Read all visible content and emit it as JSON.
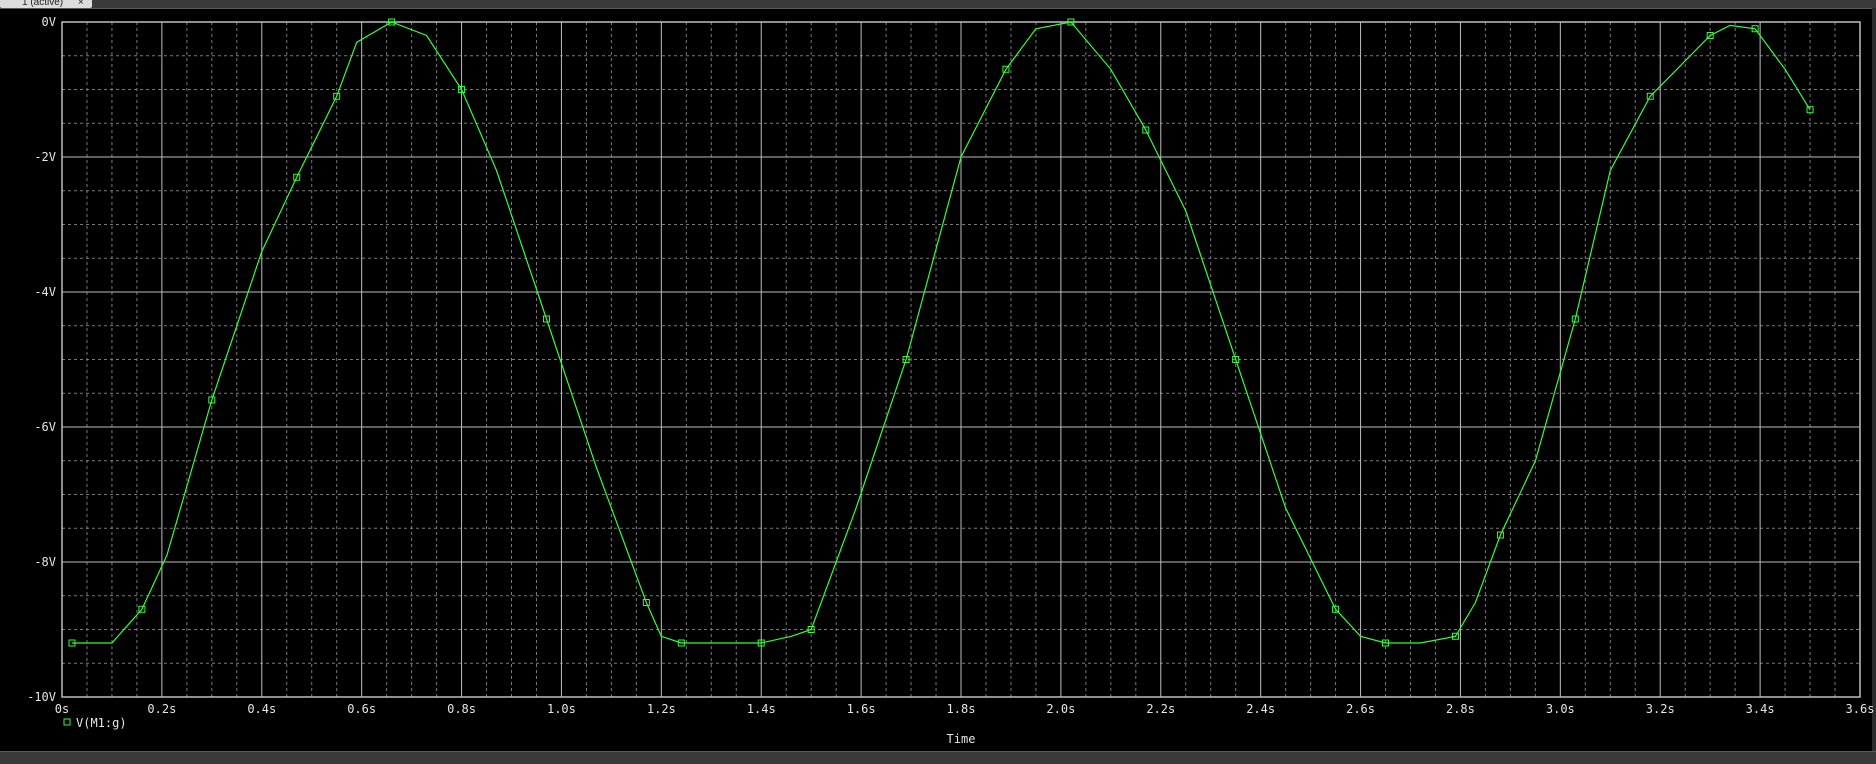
{
  "window": {
    "tab_label": "1 (active)",
    "tab_close": "×"
  },
  "colors": {
    "background": "#000000",
    "grid_major": "#bdbdbd",
    "grid_minor": "#7a7a7a",
    "trace": "#33ff33",
    "axis_text": "#e6e6e6"
  },
  "chart_data": {
    "type": "line",
    "xlabel": "Time",
    "ylabel": "",
    "xlim": [
      0,
      3.6
    ],
    "ylim": [
      -10,
      0
    ],
    "x_ticks": [
      0,
      0.2,
      0.4,
      0.6,
      0.8,
      1.0,
      1.2,
      1.4,
      1.6,
      1.8,
      2.0,
      2.2,
      2.4,
      2.6,
      2.8,
      3.0,
      3.2,
      3.4,
      3.6
    ],
    "x_tick_labels": [
      "0s",
      "0.2s",
      "0.4s",
      "0.6s",
      "0.8s",
      "1.0s",
      "1.2s",
      "1.4s",
      "1.6s",
      "1.8s",
      "2.0s",
      "2.2s",
      "2.4s",
      "2.6s",
      "2.8s",
      "3.0s",
      "3.2s",
      "3.4s",
      "3.6s"
    ],
    "y_ticks": [
      0,
      -2,
      -4,
      -6,
      -8,
      -10
    ],
    "y_tick_labels": [
      "0V",
      "-2V",
      "-4V",
      "-6V",
      "-8V",
      "-10V"
    ],
    "grid": true,
    "legend": "bottom-left",
    "series": [
      {
        "name": "V(M1:g)",
        "marker": "square",
        "x": [
          0.02,
          0.1,
          0.16,
          0.21,
          0.3,
          0.4,
          0.47,
          0.51,
          0.55,
          0.59,
          0.66,
          0.73,
          0.8,
          0.87,
          0.97,
          1.07,
          1.17,
          1.2,
          1.24,
          1.3,
          1.4,
          1.46,
          1.5,
          1.59,
          1.69,
          1.8,
          1.89,
          1.95,
          2.02,
          2.1,
          2.17,
          2.25,
          2.35,
          2.45,
          2.55,
          2.6,
          2.65,
          2.72,
          2.79,
          2.83,
          2.88,
          2.95,
          3.03,
          3.1,
          3.18,
          3.26,
          3.3,
          3.34,
          3.39,
          3.45,
          3.5
        ],
        "y": [
          -9.2,
          -9.2,
          -8.7,
          -7.9,
          -5.6,
          -3.4,
          -2.3,
          -1.7,
          -1.1,
          -0.3,
          0.0,
          -0.2,
          -1.0,
          -2.2,
          -4.4,
          -6.6,
          -8.6,
          -9.1,
          -9.2,
          -9.2,
          -9.2,
          -9.1,
          -9.0,
          -7.2,
          -5.0,
          -2.0,
          -0.7,
          -0.1,
          0.0,
          -0.7,
          -1.6,
          -2.8,
          -5.0,
          -7.2,
          -8.7,
          -9.1,
          -9.2,
          -9.2,
          -9.1,
          -8.6,
          -7.6,
          -6.5,
          -4.4,
          -2.2,
          -1.1,
          -0.5,
          -0.2,
          -0.05,
          -0.1,
          -0.7,
          -1.3
        ]
      }
    ]
  }
}
